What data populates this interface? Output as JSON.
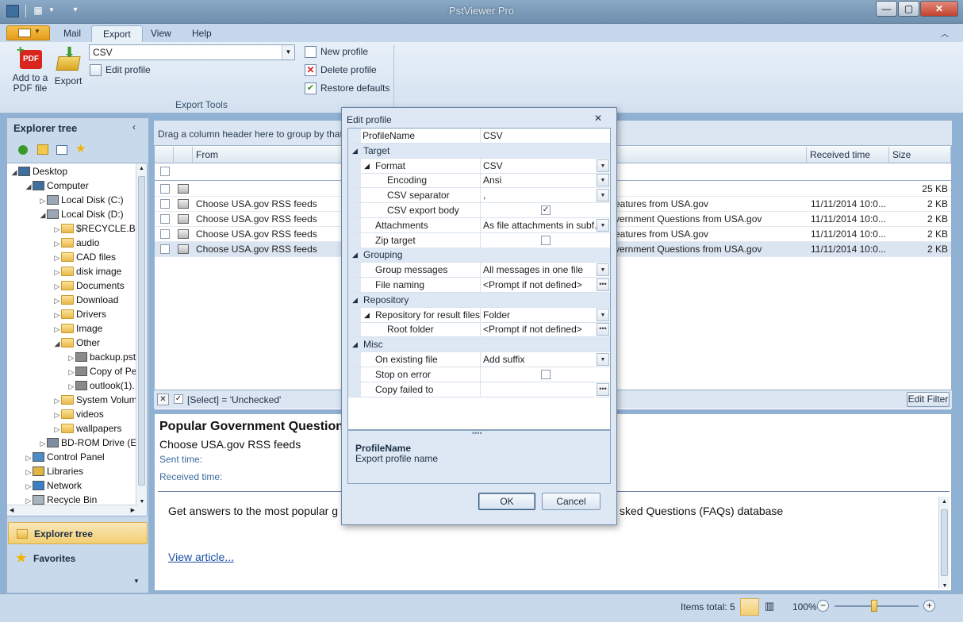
{
  "window": {
    "title": "PstViewer Pro",
    "minimize": "—",
    "maximize": "▢",
    "close": "✕"
  },
  "ribbon": {
    "tabs": [
      {
        "label": "Mail"
      },
      {
        "label": "Export"
      },
      {
        "label": "View"
      },
      {
        "label": "Help"
      }
    ],
    "active_tab": "Export",
    "add_pdf_label": "Add to a PDF file",
    "export_label": "Export",
    "profile_combo": "CSV",
    "edit_profile": "Edit profile",
    "new_profile": "New profile",
    "delete_profile": "Delete profile",
    "restore_defaults": "Restore defaults",
    "group_label": "Export Tools"
  },
  "explorer": {
    "title": "Explorer tree",
    "tree": [
      {
        "label": "Desktop",
        "level": 0,
        "arrow": "◢",
        "icon": "monitor"
      },
      {
        "label": "Computer",
        "level": 1,
        "arrow": "◢",
        "icon": "computer"
      },
      {
        "label": "Local Disk (C:)",
        "level": 2,
        "arrow": "▷",
        "icon": "disk"
      },
      {
        "label": "Local Disk (D:)",
        "level": 2,
        "arrow": "◢",
        "icon": "disk"
      },
      {
        "label": "$RECYCLE.BIN",
        "level": 3,
        "arrow": "▷",
        "icon": "folder"
      },
      {
        "label": "audio",
        "level": 3,
        "arrow": "▷",
        "icon": "folder"
      },
      {
        "label": "CAD files",
        "level": 3,
        "arrow": "▷",
        "icon": "folder"
      },
      {
        "label": "disk image",
        "level": 3,
        "arrow": "▷",
        "icon": "folder"
      },
      {
        "label": "Documents",
        "level": 3,
        "arrow": "▷",
        "icon": "folder"
      },
      {
        "label": "Download",
        "level": 3,
        "arrow": "▷",
        "icon": "folder"
      },
      {
        "label": "Drivers",
        "level": 3,
        "arrow": "▷",
        "icon": "folder"
      },
      {
        "label": "Image",
        "level": 3,
        "arrow": "▷",
        "icon": "folder"
      },
      {
        "label": "Other",
        "level": 3,
        "arrow": "◢",
        "icon": "folder"
      },
      {
        "label": "backup.pst",
        "level": 4,
        "arrow": "▷",
        "icon": "pst"
      },
      {
        "label": "Copy of Pe",
        "level": 4,
        "arrow": "▷",
        "icon": "pst"
      },
      {
        "label": "outlook(1).",
        "level": 4,
        "arrow": "▷",
        "icon": "pst"
      },
      {
        "label": "System Volume",
        "level": 3,
        "arrow": "▷",
        "icon": "folder"
      },
      {
        "label": "videos",
        "level": 3,
        "arrow": "▷",
        "icon": "folder"
      },
      {
        "label": "wallpapers",
        "level": 3,
        "arrow": "▷",
        "icon": "folder"
      },
      {
        "label": "BD-ROM Drive (E:)",
        "level": 2,
        "arrow": "▷",
        "icon": "disc"
      },
      {
        "label": "Control Panel",
        "level": 1,
        "arrow": "▷",
        "icon": "panel"
      },
      {
        "label": "Libraries",
        "level": 1,
        "arrow": "▷",
        "icon": "library"
      },
      {
        "label": "Network",
        "level": 1,
        "arrow": "▷",
        "icon": "network"
      },
      {
        "label": "Recycle Bin",
        "level": 1,
        "arrow": "▷",
        "icon": "bin"
      }
    ],
    "nav_tree": "Explorer tree",
    "nav_favorites": "Favorites"
  },
  "grid": {
    "group_hint": "Drag a column header here to group by that colu",
    "headers": {
      "from": "From",
      "received": "Received time",
      "size": "Size"
    },
    "rows": [
      {
        "from": "",
        "subject": "",
        "received": "",
        "size": "25 KB"
      },
      {
        "from": "Choose USA.gov RSS feeds",
        "subject": "eatures from USA.gov",
        "received": "11/11/2014 10:0...",
        "size": "2 KB"
      },
      {
        "from": "Choose USA.gov RSS feeds",
        "subject": "vernment Questions from USA.gov",
        "received": "11/11/2014 10:0...",
        "size": "2 KB"
      },
      {
        "from": "Choose USA.gov RSS feeds",
        "subject": "eatures from USA.gov",
        "received": "11/11/2014 10:0...",
        "size": "2 KB"
      },
      {
        "from": "Choose USA.gov RSS feeds",
        "subject": "vernment Questions from USA.gov",
        "received": "11/11/2014 10:0...",
        "size": "2 KB"
      }
    ],
    "filter_text": "[Select] = 'Unchecked'",
    "edit_filter": "Edit Filter"
  },
  "preview": {
    "subject": "Popular Government Question",
    "from": "Choose USA.gov RSS feeds",
    "sent_label": "Sent time:",
    "received_label": "Received time:",
    "body_start": "Get answers to the most popular g",
    "body_end": "sked Questions (FAQs) database",
    "link": "View article..."
  },
  "status": {
    "items_total": "Items total: 5",
    "zoom": "100%"
  },
  "dialog": {
    "title": "Edit profile",
    "close": "✕",
    "properties": [
      {
        "kind": "prop",
        "indent": 1,
        "name": "ProfileName",
        "value": "CSV",
        "editor": "none"
      },
      {
        "kind": "cat",
        "indent": 0,
        "name": "Target"
      },
      {
        "kind": "prop",
        "indent": 1,
        "name": "Format",
        "value": "CSV",
        "editor": "dropdown",
        "expander": "◢"
      },
      {
        "kind": "prop",
        "indent": 2,
        "name": "Encoding",
        "value": "Ansi",
        "editor": "dropdown"
      },
      {
        "kind": "prop",
        "indent": 2,
        "name": "CSV separator",
        "value": ",",
        "editor": "dropdown"
      },
      {
        "kind": "prop",
        "indent": 2,
        "name": "CSV export body",
        "value": "",
        "editor": "checked"
      },
      {
        "kind": "prop",
        "indent": 1,
        "name": "Attachments",
        "value": "As file attachments in subf...",
        "editor": "dropdown"
      },
      {
        "kind": "prop",
        "indent": 1,
        "name": "Zip target",
        "value": "",
        "editor": "unchecked"
      },
      {
        "kind": "cat",
        "indent": 0,
        "name": "Grouping"
      },
      {
        "kind": "prop",
        "indent": 1,
        "name": "Group messages",
        "value": "All messages in one file",
        "editor": "dropdown"
      },
      {
        "kind": "prop",
        "indent": 1,
        "name": "File naming",
        "value": "<Prompt if not defined>",
        "editor": "ellipsis"
      },
      {
        "kind": "cat",
        "indent": 0,
        "name": "Repository"
      },
      {
        "kind": "prop",
        "indent": 1,
        "name": "Repository for result files",
        "value": "Folder",
        "editor": "dropdown",
        "expander": "◢"
      },
      {
        "kind": "prop",
        "indent": 2,
        "name": "Root folder",
        "value": "<Prompt if not defined>",
        "editor": "ellipsis"
      },
      {
        "kind": "cat",
        "indent": 0,
        "name": "Misc"
      },
      {
        "kind": "prop",
        "indent": 1,
        "name": "On existing file",
        "value": "Add suffix",
        "editor": "dropdown"
      },
      {
        "kind": "prop",
        "indent": 1,
        "name": "Stop on error",
        "value": "",
        "editor": "unchecked"
      },
      {
        "kind": "prop",
        "indent": 1,
        "name": "Copy failed to",
        "value": "",
        "editor": "ellipsis"
      }
    ],
    "desc_title": "ProfileName",
    "desc_text": "Export profile name",
    "ok": "OK",
    "cancel": "Cancel"
  }
}
